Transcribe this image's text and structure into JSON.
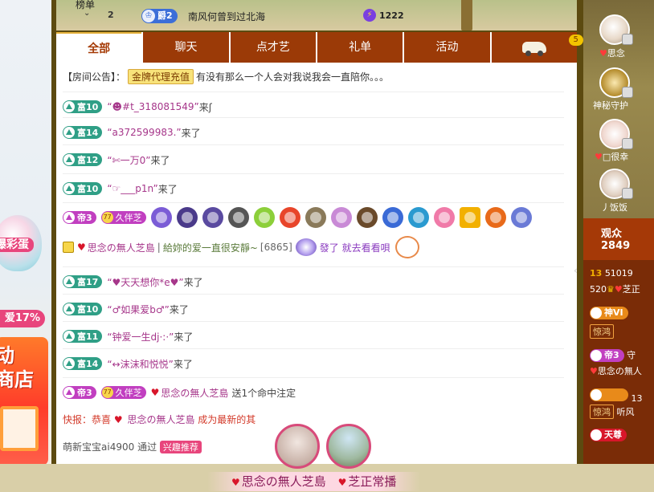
{
  "left": {
    "egg_label": "爆彩蛋",
    "percent": "爱17%",
    "shop_line1": "动",
    "shop_line2": "商店"
  },
  "topbar": {
    "rank_label": "榜单",
    "rank_num": "2",
    "badge_label": "爵2",
    "nickname": "南风何曾到过北海",
    "bolt_value": "1222"
  },
  "tabs": [
    {
      "label": "全部",
      "active": true
    },
    {
      "label": "聊天"
    },
    {
      "label": "点才艺"
    },
    {
      "label": "礼单"
    },
    {
      "label": "活动"
    },
    {
      "label": "",
      "count": "5",
      "icon": "car-icon"
    }
  ],
  "notice": {
    "prefix": "【房间公告】：",
    "tag": "金牌代理充值",
    "text": "有没有那么一个人会对我说我会一直陪你。。。"
  },
  "messages": [
    {
      "level": "富10",
      "user": "“☻#t_318081549”",
      "suffix": "来ʃ"
    },
    {
      "level": "富14",
      "user": "“a372599983.”",
      "suffix": "来了"
    },
    {
      "level": "富12",
      "user": "“✄一万0”",
      "suffix": "来了"
    },
    {
      "level": "富10",
      "user": "“☞___p1n”",
      "suffix": "来了"
    },
    {
      "level": "富17",
      "user": "“♥天天想你*e♥”",
      "suffix": "来了"
    },
    {
      "level": "富10",
      "user": "“♂如果爱b♂”",
      "suffix": "来了"
    },
    {
      "level": "富11",
      "user": "“钟爱一生dj·:·”",
      "suffix": "来了"
    },
    {
      "level": "富14",
      "user": "“↔沫沫和悦悦”",
      "suffix": "来了"
    }
  ],
  "vip_row": {
    "level": "帝3",
    "companion": "久伴芝"
  },
  "chat_line": {
    "name": "思念の無人芝島",
    "sep": "|",
    "text": "給妳的爱一直很安靜~",
    "count": "[6865]",
    "msg": "發了 就去看看唄"
  },
  "gift_line": {
    "level": "帝3",
    "companion": "久伴芝",
    "name": "思念の無人芝島",
    "text": "送1个命中注定"
  },
  "news": {
    "prefix": "快报：恭喜",
    "name": "思念の無人芝島",
    "text": "成为最新的其"
  },
  "bottom": {
    "user": "萌新宝宝ai4900",
    "via": "通过",
    "tag": "兴趣推荐"
  },
  "banner": {
    "name1": "思念の無人芝島",
    "name2": "芝正常播"
  },
  "right": {
    "avatars": [
      {
        "label": "思念"
      },
      {
        "label": "神秘守护"
      },
      {
        "label": "□很幸"
      },
      {
        "label": "丿饭饭"
      }
    ],
    "watch_title": "观众",
    "watch_count": "2849",
    "r1": "13",
    "r1b": "51019",
    "r2": "520",
    "r2b": "芝正",
    "r3": "神VI",
    "r4": "惊鸿",
    "r5": "帝3",
    "r5b": "守",
    "r6": "思念の無人",
    "r7": "13",
    "r8": "惊鸿",
    "r8b": "听风",
    "r9": "天尊"
  }
}
